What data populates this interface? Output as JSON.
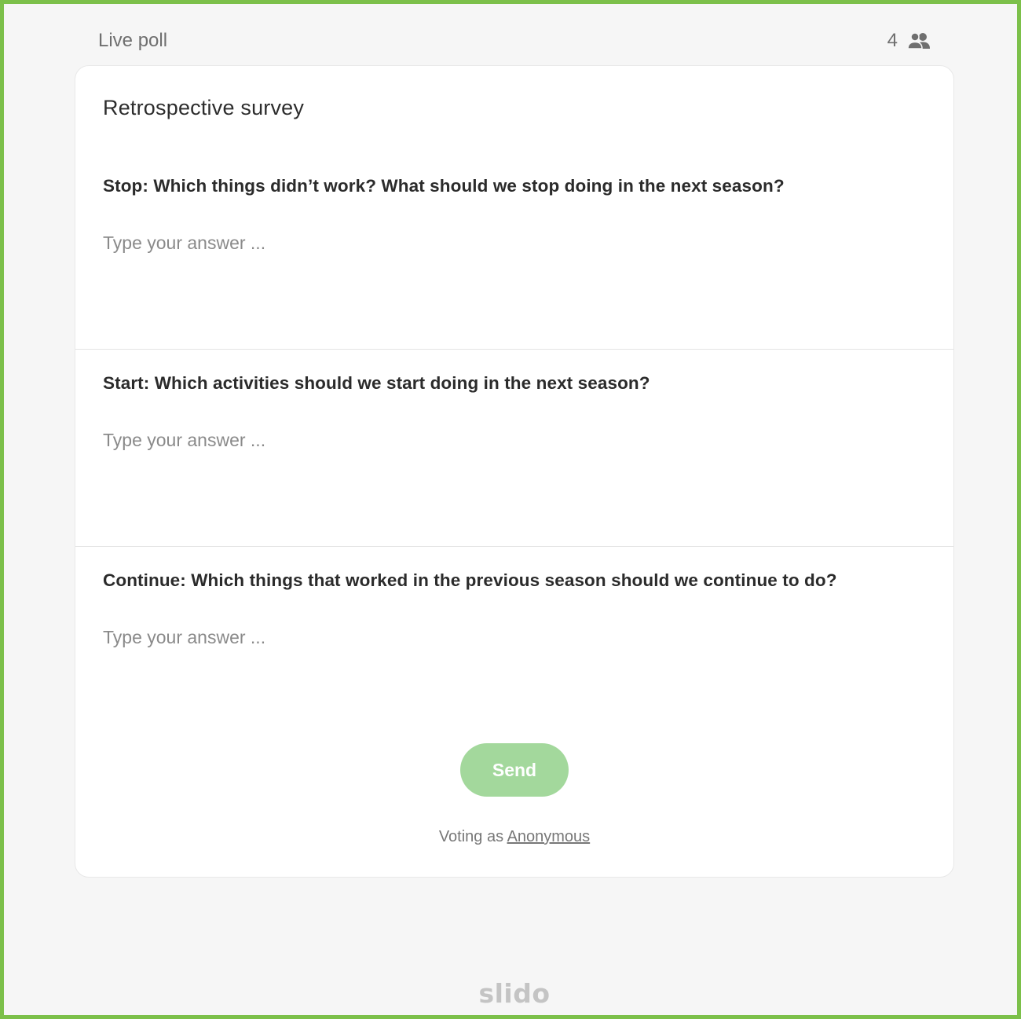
{
  "header": {
    "title": "Live poll",
    "participant_count": "4",
    "participant_icon": "people-icon"
  },
  "survey": {
    "title": "Retrospective survey",
    "questions": [
      {
        "label": "Stop: Which things didn’t work? What should we stop doing in the next season?",
        "placeholder": "Type your answer ...",
        "value": ""
      },
      {
        "label": "Start: Which activities should we start doing in the next season?",
        "placeholder": "Type your answer ...",
        "value": ""
      },
      {
        "label": "Continue: Which things that worked in the previous season should we continue to do?",
        "placeholder": "Type your answer ...",
        "value": ""
      }
    ],
    "send_label": "Send",
    "voting_prefix": "Voting as",
    "voting_name": "Anonymous"
  },
  "branding": {
    "logo": "slido"
  },
  "colors": {
    "frame_border": "#7cc04a",
    "send_button": "#a3d89c"
  }
}
